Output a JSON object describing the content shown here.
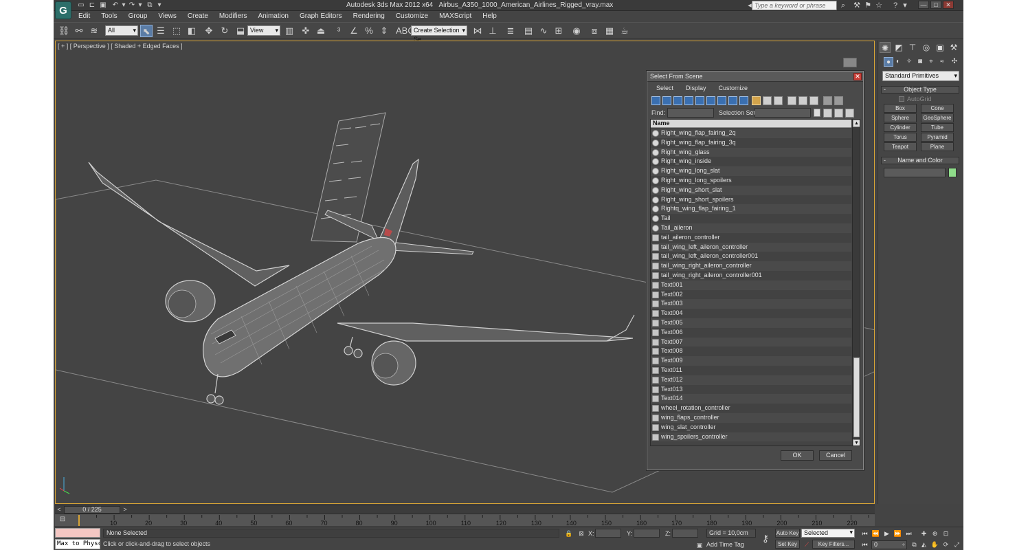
{
  "app": {
    "title_product": "Autodesk 3ds Max  2012 x64",
    "title_file": "Airbus_A350_1000_American_Airlines_Rigged_vray.max",
    "search_placeholder": "Type a keyword or phrase"
  },
  "menu": [
    "Edit",
    "Tools",
    "Group",
    "Views",
    "Create",
    "Modifiers",
    "Animation",
    "Graph Editors",
    "Rendering",
    "Customize",
    "MAXScript",
    "Help"
  ],
  "toolbar": {
    "selection_filter": "All",
    "ref_coord": "View",
    "named_selection": "Create Selection Se"
  },
  "viewport": {
    "label": "[ + ] [ Perspective ] [ Shaded + Edged Faces ]",
    "wireframe_color": "#c8c8c8",
    "selection_border_color": "#d8a536"
  },
  "dialog": {
    "title": "Select From Scene",
    "menus": [
      "Select",
      "Display",
      "Customize"
    ],
    "find_label": "Find:",
    "selection_set_label": "Selection Set:",
    "column_name": "Name",
    "items": [
      {
        "name": "Right_wing_flap_fairing_2q",
        "kind": "geometry"
      },
      {
        "name": "Right_wing_flap_fairing_3q",
        "kind": "geometry"
      },
      {
        "name": "Right_wing_glass",
        "kind": "geometry"
      },
      {
        "name": "Right_wing_inside",
        "kind": "geometry"
      },
      {
        "name": "Right_wing_long_slat",
        "kind": "geometry"
      },
      {
        "name": "Right_wing_long_spoilers",
        "kind": "geometry"
      },
      {
        "name": "Right_wing_short_slat",
        "kind": "geometry"
      },
      {
        "name": "Right_wing_short_spoilers",
        "kind": "geometry"
      },
      {
        "name": "Rightq_wing_flap_fairing_1",
        "kind": "geometry"
      },
      {
        "name": "Tail",
        "kind": "geometry"
      },
      {
        "name": "Tail_aileron",
        "kind": "geometry"
      },
      {
        "name": "tail_aileron_controller",
        "kind": "helper"
      },
      {
        "name": "tail_wing_left_aileron_controller",
        "kind": "helper"
      },
      {
        "name": "tail_wing_left_aileron_controller001",
        "kind": "helper"
      },
      {
        "name": "tail_wing_right_aileron_controller",
        "kind": "helper"
      },
      {
        "name": "tail_wing_right_aileron_controller001",
        "kind": "helper"
      },
      {
        "name": "Text001",
        "kind": "helper"
      },
      {
        "name": "Text002",
        "kind": "helper"
      },
      {
        "name": "Text003",
        "kind": "helper"
      },
      {
        "name": "Text004",
        "kind": "helper"
      },
      {
        "name": "Text005",
        "kind": "helper"
      },
      {
        "name": "Text006",
        "kind": "helper"
      },
      {
        "name": "Text007",
        "kind": "helper"
      },
      {
        "name": "Text008",
        "kind": "helper"
      },
      {
        "name": "Text009",
        "kind": "helper"
      },
      {
        "name": "Text011",
        "kind": "helper"
      },
      {
        "name": "Text012",
        "kind": "helper"
      },
      {
        "name": "Text013",
        "kind": "helper"
      },
      {
        "name": "Text014",
        "kind": "helper"
      },
      {
        "name": "wheel_rotation_controller",
        "kind": "helper"
      },
      {
        "name": "wing_flaps_controller",
        "kind": "helper"
      },
      {
        "name": "wing_slat_controller",
        "kind": "helper"
      },
      {
        "name": "wing_spoilers_controller",
        "kind": "helper"
      }
    ],
    "ok_label": "OK",
    "cancel_label": "Cancel"
  },
  "command_panel": {
    "category": "Standard Primitives",
    "object_type_title": "Object Type",
    "autogrid_label": "AutoGrid",
    "buttons": [
      "Box",
      "Cone",
      "Sphere",
      "GeoSphere",
      "Cylinder",
      "Tube",
      "Torus",
      "Pyramid",
      "Teapot",
      "Plane"
    ],
    "name_color_title": "Name and Color",
    "object_color": "#8fdc8a"
  },
  "timeline": {
    "range_label": "0 / 225",
    "ticks": [
      "10",
      "20",
      "30",
      "40",
      "50",
      "60",
      "70",
      "80",
      "90",
      "100",
      "110",
      "120",
      "130",
      "140",
      "150",
      "160",
      "170",
      "180",
      "190",
      "200",
      "210",
      "220"
    ]
  },
  "status": {
    "listener": "Max to Physc",
    "selection": "None Selected",
    "prompt": "Click or click-and-drag to select objects",
    "x_label": "X:",
    "y_label": "Y:",
    "z_label": "Z:",
    "grid": "Grid = 10,0cm",
    "add_time_tag": "Add Time Tag",
    "auto_key": "Auto Key",
    "set_key": "Set Key",
    "key_mode": "Selected",
    "key_filters": "Key Filters...",
    "current_frame": "0"
  }
}
